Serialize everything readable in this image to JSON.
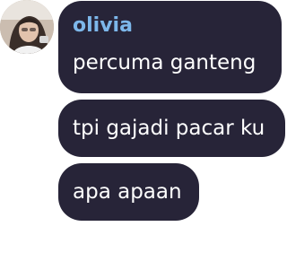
{
  "sender": {
    "name": "olivia",
    "name_color": "#7db7ea"
  },
  "messages": [
    {
      "text": "percuma ganteng"
    },
    {
      "text": "tpi gajadi pacar ku"
    },
    {
      "text": "apa apaan"
    }
  ],
  "colors": {
    "bubble": "#272438",
    "text": "#ffffff",
    "background": "#ffffff"
  },
  "avatar": {
    "icon": "user-avatar-photo"
  }
}
